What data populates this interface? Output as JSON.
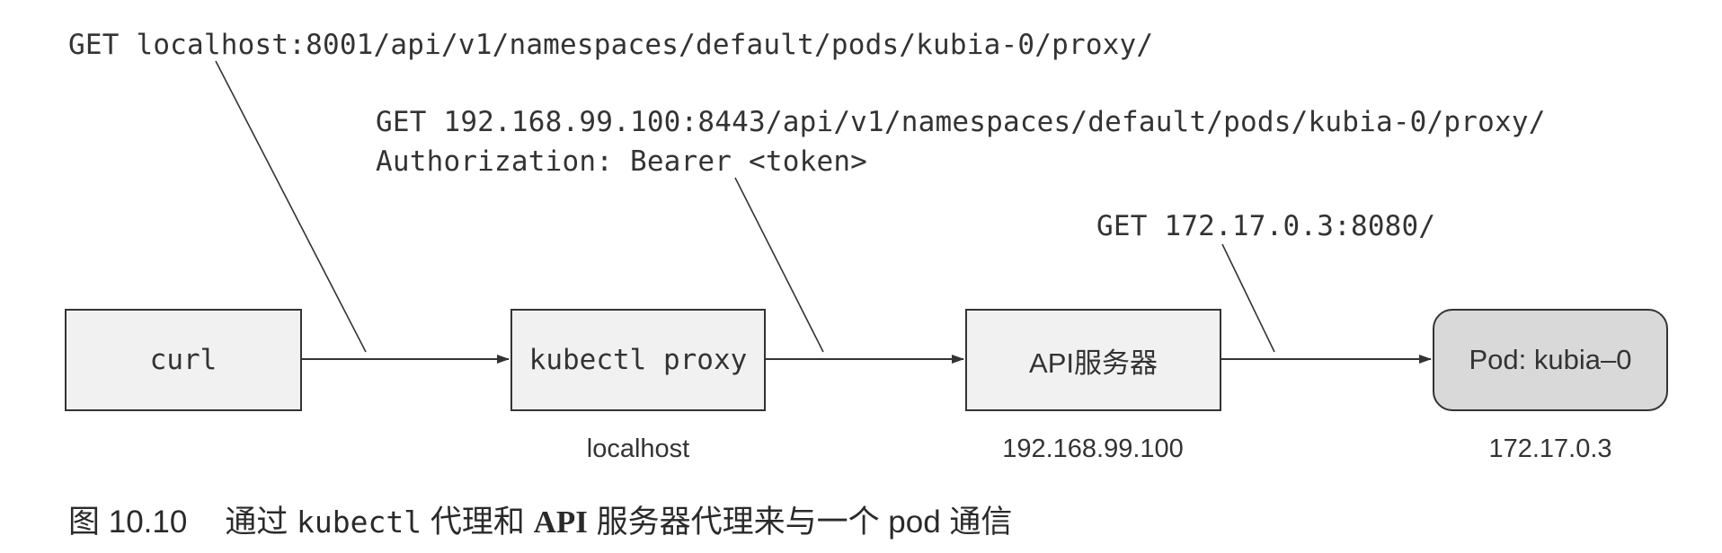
{
  "requests": {
    "client_to_proxy": "GET localhost:8001/api/v1/namespaces/default/pods/kubia-0/proxy/",
    "proxy_to_api_line1": "GET 192.168.99.100:8443/api/v1/namespaces/default/pods/kubia-0/proxy/",
    "proxy_to_api_line2": "Authorization: Bearer <token>",
    "api_to_pod": "GET 172.17.0.3:8080/"
  },
  "nodes": {
    "curl": "curl",
    "kubectl_proxy": "kubectl proxy",
    "api_server": "API服务器",
    "pod": "Pod: kubia–0"
  },
  "addresses": {
    "kubectl_proxy": "localhost",
    "api_server": "192.168.99.100",
    "pod": "172.17.0.3"
  },
  "caption": {
    "figure_number": "图 10.10",
    "part1": "通过 ",
    "command": "kubectl",
    "part2": " 代理和 ",
    "api": "API",
    "part3": " 服务器代理来与一个 pod 通信"
  },
  "colors": {
    "line": "#333333",
    "box_fill": "#f1f1f1",
    "pod_fill": "#d9d9d9"
  }
}
